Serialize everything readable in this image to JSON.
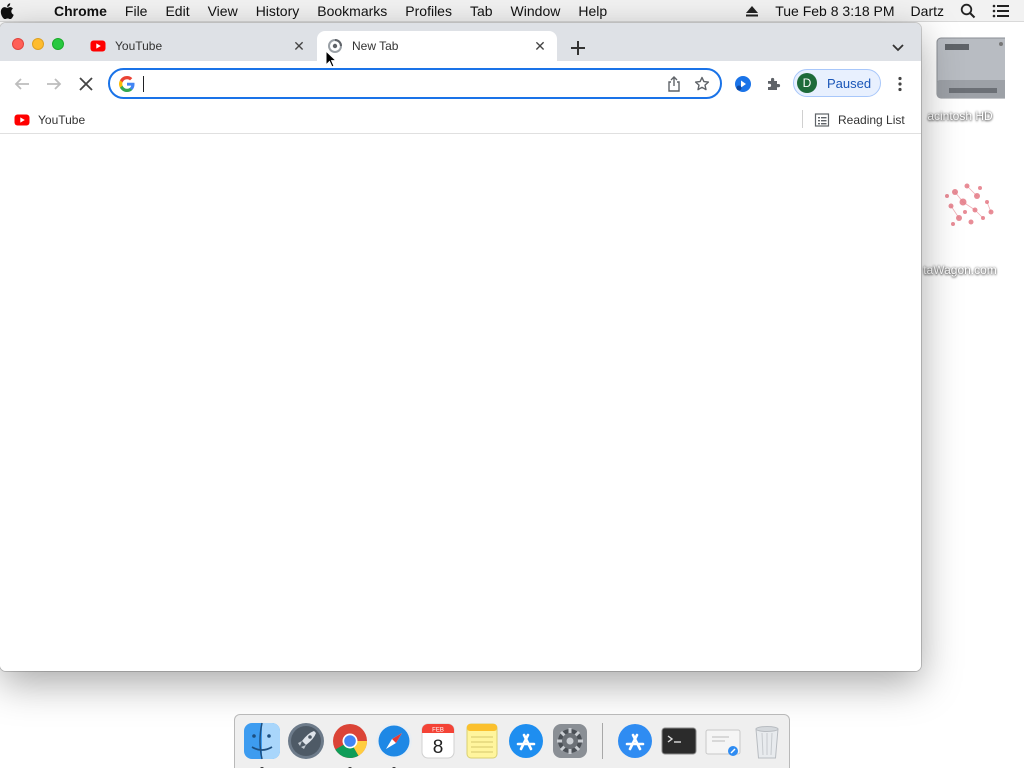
{
  "menubar": {
    "app_name": "Chrome",
    "items": [
      "File",
      "Edit",
      "View",
      "History",
      "Bookmarks",
      "Profiles",
      "Tab",
      "Window",
      "Help"
    ],
    "datetime": "Tue Feb 8  3:18 PM",
    "user": "Dartz"
  },
  "desktop": {
    "icons": [
      {
        "label": "acintosh HD",
        "icon": "hard-drive-icon"
      },
      {
        "label": "taWagon.com",
        "icon": "image-file-icon"
      }
    ]
  },
  "browser": {
    "tabs": [
      {
        "title": "YouTube",
        "icon": "youtube-icon",
        "active": false
      },
      {
        "title": "New Tab",
        "icon": "loading-icon",
        "active": true
      }
    ],
    "omnibox": {
      "value": "",
      "placeholder": ""
    },
    "profile": {
      "initial": "D",
      "status": "Paused"
    },
    "bookmarks": [
      {
        "label": "YouTube",
        "icon": "youtube-icon"
      }
    ],
    "reading_list_label": "Reading List"
  },
  "dock": {
    "apps": [
      {
        "name": "Finder",
        "running": true
      },
      {
        "name": "Launchpad",
        "running": false
      },
      {
        "name": "Google Chrome",
        "running": true
      },
      {
        "name": "Safari",
        "running": true
      },
      {
        "name": "Calendar",
        "running": false,
        "month": "FEB",
        "day": "8"
      },
      {
        "name": "Notes",
        "running": false
      },
      {
        "name": "App Store",
        "running": false
      },
      {
        "name": "System Preferences",
        "running": false
      }
    ],
    "others": [
      {
        "name": "Applications folder"
      },
      {
        "name": "Terminal"
      },
      {
        "name": "Mail document"
      },
      {
        "name": "Trash"
      }
    ]
  },
  "colors": {
    "accent": "#1a73e8",
    "youtube_red": "#ff0000",
    "tabstrip_bg": "#dee1e6"
  }
}
